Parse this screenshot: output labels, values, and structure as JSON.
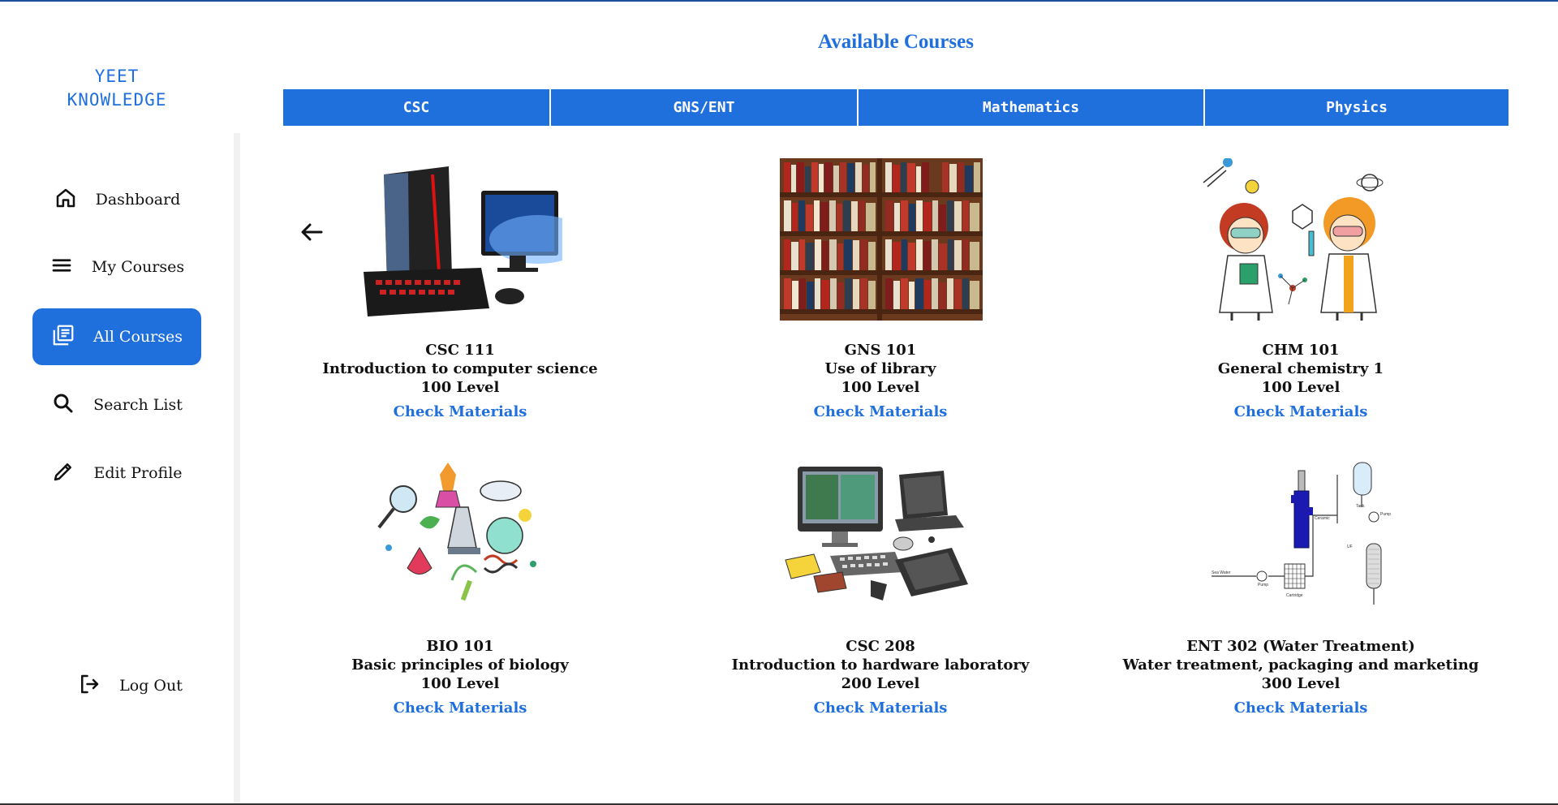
{
  "sidebar": {
    "logo_line1": "YEET",
    "logo_line2": "KNOWLEDGE",
    "items": [
      {
        "label": "Dashboard",
        "icon": "home-icon"
      },
      {
        "label": "My Courses",
        "icon": "menu-icon"
      },
      {
        "label": "All Courses",
        "icon": "library-icon"
      },
      {
        "label": "Search List",
        "icon": "search-icon"
      },
      {
        "label": "Edit Profile",
        "icon": "pencil-icon"
      }
    ],
    "logout_label": "Log Out",
    "active_color": "#1f6fdd"
  },
  "main": {
    "title": "Available Courses",
    "tabs": [
      {
        "label": "CSC"
      },
      {
        "label": "GNS/ENT"
      },
      {
        "label": "Mathematics"
      },
      {
        "label": "Physics"
      }
    ],
    "link_label": "Check Materials",
    "courses": [
      {
        "code": "CSC 111",
        "name": "Introduction to computer science",
        "level": "100 Level",
        "image": "desktop-computer-image"
      },
      {
        "code": "GNS 101",
        "name": "Use of library",
        "level": "100 Level",
        "image": "bookshelf-image"
      },
      {
        "code": "CHM 101",
        "name": "General chemistry 1",
        "level": "100 Level",
        "image": "scientists-image"
      },
      {
        "code": "BIO 101",
        "name": "Basic principles of biology",
        "level": "100 Level",
        "image": "biology-collage-image"
      },
      {
        "code": "CSC 208",
        "name": "Introduction to hardware laboratory",
        "level": "200 Level",
        "image": "hardware-devices-image"
      },
      {
        "code": "ENT 302 (Water Treatment)",
        "name": "Water treatment, packaging and marketing",
        "level": "300 Level",
        "image": "water-treatment-diagram-image"
      }
    ]
  },
  "colors": {
    "brand": "#1f6fdd",
    "text": "#111111",
    "divider": "#f1f1f1"
  }
}
